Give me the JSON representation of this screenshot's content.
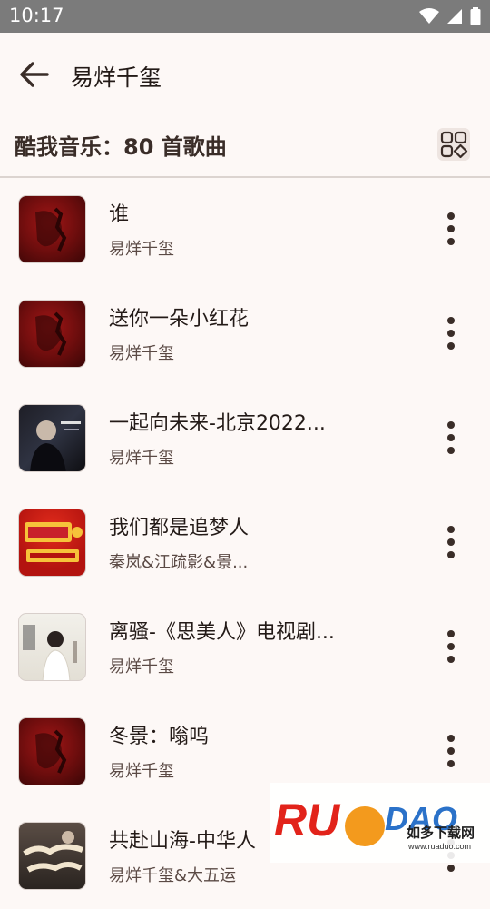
{
  "status_bar": {
    "time": "10:17"
  },
  "app_bar": {
    "title": "易烊千玺"
  },
  "header": {
    "count_title": "酷我音乐：80 首歌曲"
  },
  "songs": [
    {
      "title": "谁",
      "artist": "易烊千玺",
      "art": "red-album-cover"
    },
    {
      "title": "送你一朵小红花",
      "artist": "易烊千玺",
      "art": "red-album-cover"
    },
    {
      "title": "一起向未来-北京2022...",
      "artist": "易烊千玺",
      "art": "dark-portrait-cover"
    },
    {
      "title": "我们都是追梦人",
      "artist": "秦岚&江疏影&景...",
      "art": "2019-gala-cover"
    },
    {
      "title": "离骚-《思美人》电视剧...",
      "artist": "易烊千玺",
      "art": "light-drama-cover"
    },
    {
      "title": "冬景：嗡呜",
      "artist": "易烊千玺",
      "art": "red-album-cover"
    },
    {
      "title": "共赴山海-中华人",
      "artist": "易烊千玺&大五运",
      "art": "poster-cover"
    }
  ],
  "watermark": {
    "brand": "RUANDAO",
    "subtitle": "如多下载网",
    "url": "www.ruaduo.com"
  },
  "colors": {
    "background": "#fdf8f6",
    "status_bar": "#7b7b7b",
    "accent_red": "#a11616"
  }
}
